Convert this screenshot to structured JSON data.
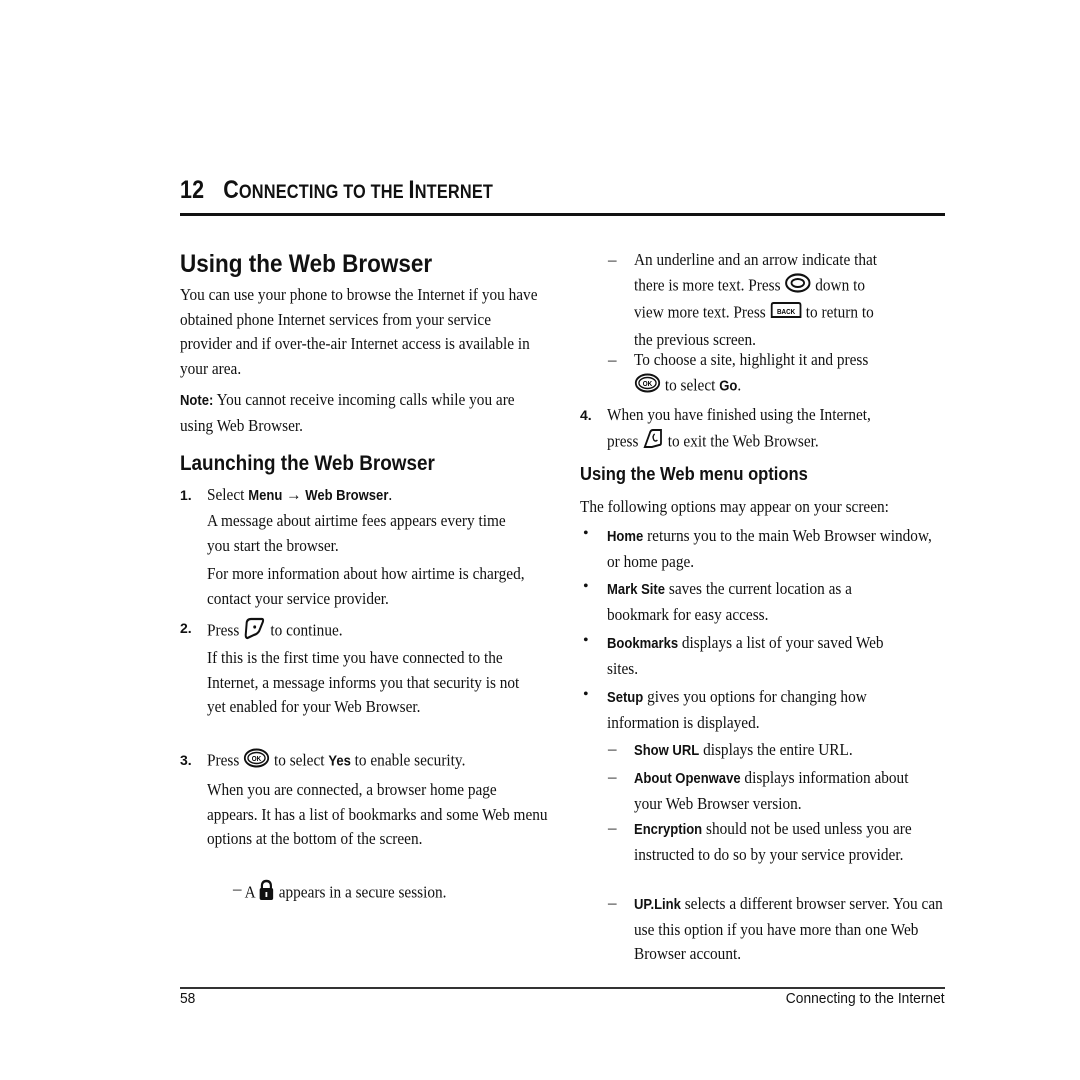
{
  "chapter": {
    "number": "12",
    "title_parts": [
      "C",
      "ONNECTING TO THE ",
      "I",
      "NTERNET"
    ]
  },
  "left": {
    "heading": "Using the Web Browser",
    "intro": "You can use your phone to browse the Internet if you have obtained phone Internet services from your service provider and if over-the-air Internet access is available in your area.",
    "note_label": "Note:",
    "note_text": " You cannot receive incoming calls while you are using Web Browser.",
    "subheading": "Launching the Web Browser",
    "step1": {
      "num": "1.",
      "pre": "Select ",
      "menu": "Menu",
      "arrow": " → ",
      "target": "Web Browser",
      "post": "."
    },
    "step1_p1": "A message about airtime fees appears every time you start the browser.",
    "step1_p2": "For more information about how airtime is charged, contact your service provider.",
    "step2": {
      "num": "2.",
      "pre": "Press ",
      "icon": "left-softkey-icon",
      "post": " to continue."
    },
    "step2_p1": "If this is the first time you have connected to the Internet, a message informs you that security is not yet enabled for your Web Browser.",
    "step3": {
      "num": "3.",
      "pre": "Press ",
      "icon": "ok-key-icon",
      "mid": " to select ",
      "yes": "Yes",
      "post": " to enable security."
    },
    "step3_p1": "When you are connected, a browser home page appears. It has a list of bookmarks and some Web menu options at the bottom of the screen.",
    "step3_sub": {
      "dash": "–",
      "pre": "A ",
      "icon": "lock-icon",
      "post": " appears in a secure session."
    }
  },
  "right": {
    "sub1": {
      "dash": "–",
      "line1": "An underline and an arrow indicate that",
      "pre2": "there is more text. Press ",
      "icon_nav": "navigation-key-icon",
      "post2": " down to",
      "pre3": "view more text. Press ",
      "icon_back": "back-key-icon",
      "back_label": "BACK",
      "post3": " to return to",
      "line4": "the previous screen."
    },
    "sub2": {
      "dash": "–",
      "line1": "To choose a site, highlight it and press",
      "icon": "ok-key-icon",
      "mid": " to select ",
      "go": "Go",
      "post": "."
    },
    "step4": {
      "num": "4.",
      "line1": "When you have finished using the Internet,",
      "pre2": "press ",
      "icon": "end-key-icon",
      "post2": " to exit the Web Browser."
    },
    "heading": "Using the Web menu options",
    "intro": "The following options may appear on your screen:",
    "bullets": [
      {
        "term": "Home",
        "text": " returns you to the main Web Browser window, or home page."
      },
      {
        "term": "Mark Site",
        "text": " saves the current location as a bookmark for easy access."
      },
      {
        "term": "Bookmarks",
        "text": " displays a list of your saved Web sites."
      },
      {
        "term": "Setup",
        "text": " gives you options for changing how information is displayed."
      }
    ],
    "subitems": [
      {
        "term": "Show URL",
        "text": " displays the entire URL."
      },
      {
        "term": "About Openwave",
        "text": " displays information about your Web Browser version."
      },
      {
        "term": "Encryption",
        "text": " should not be used unless you are instructed to do so by your service provider."
      },
      {
        "term": "UP.Link",
        "text": " selects a different browser server. You can use this option if you have more than one Web Browser account."
      }
    ]
  },
  "footer": {
    "page": "58",
    "section": "Connecting to the Internet"
  }
}
